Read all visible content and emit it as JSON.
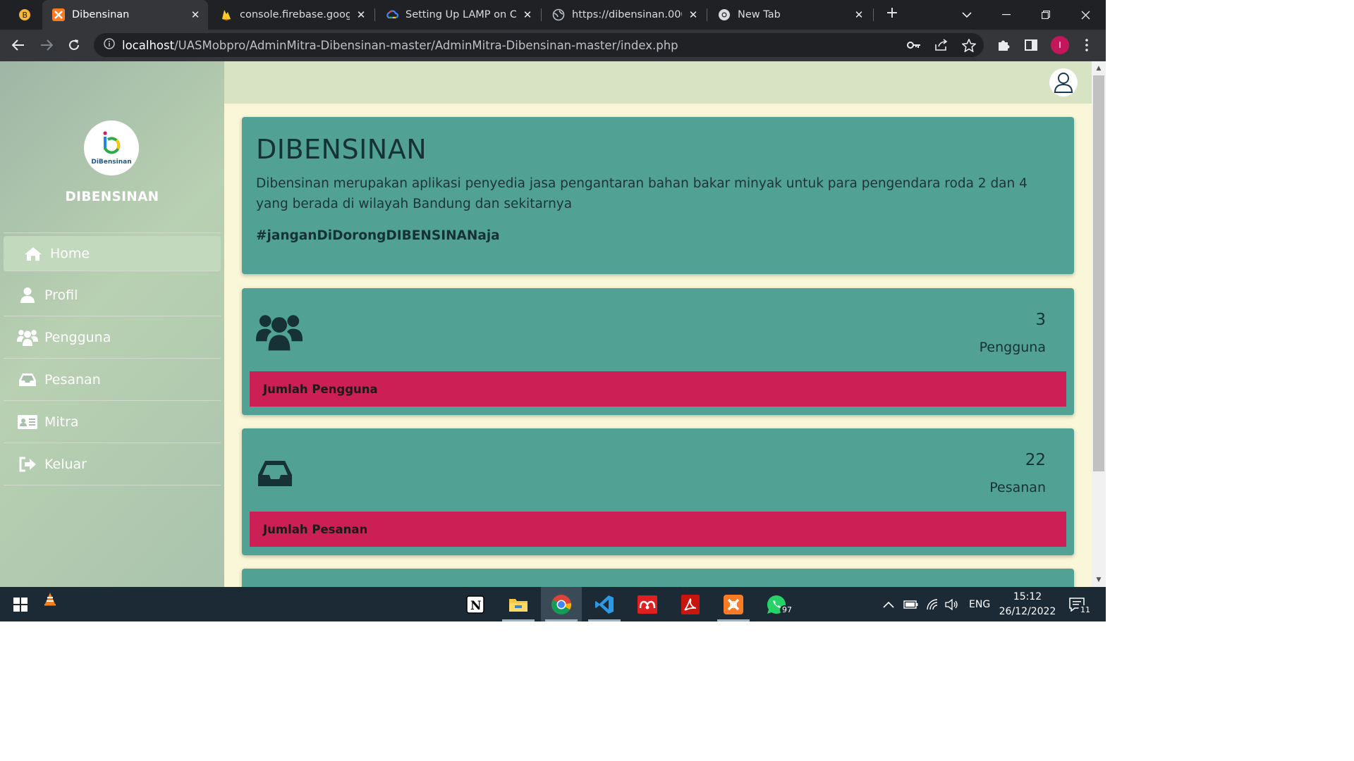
{
  "browser": {
    "tabs": [
      {
        "title": "Dibensinan",
        "active": true
      },
      {
        "title": "console.firebase.google.",
        "active": false
      },
      {
        "title": "Setting Up LAMP on Co",
        "active": false
      },
      {
        "title": "https://dibensinan.000w",
        "active": false
      },
      {
        "title": "New Tab",
        "active": false
      }
    ],
    "url_host": "localhost",
    "url_path": "/UASMobpro/AdminMitra-Dibensinan-master/AdminMitra-Dibensinan-master/index.php",
    "profile_initial": "I"
  },
  "sidebar": {
    "logo_text": "DiBensinan",
    "brand": "DIBENSINAN",
    "items": [
      {
        "label": "Home",
        "icon": "home-icon",
        "active": true
      },
      {
        "label": "Profil",
        "icon": "user-icon",
        "active": false
      },
      {
        "label": "Pengguna",
        "icon": "users-icon",
        "active": false
      },
      {
        "label": "Pesanan",
        "icon": "inbox-icon",
        "active": false
      },
      {
        "label": "Mitra",
        "icon": "id-card-icon",
        "active": false
      },
      {
        "label": "Keluar",
        "icon": "sign-out-icon",
        "active": false
      }
    ]
  },
  "main": {
    "title": "DIBENSINAN",
    "description": "Dibensinan merupakan aplikasi penyedia jasa pengantaran bahan bakar minyak untuk para pengendara roda 2 dan 4 yang berada di wilayah Bandung dan sekitarnya",
    "hashtag": "#janganDiDorongDIBENSINANaja",
    "cards": [
      {
        "count": "3",
        "label": "Pengguna",
        "footer": "Jumlah Pengguna",
        "icon": "users-icon"
      },
      {
        "count": "22",
        "label": "Pesanan",
        "footer": "Jumlah Pesanan",
        "icon": "inbox-icon"
      }
    ]
  },
  "taskbar": {
    "language": "ENG",
    "time": "15:12",
    "date": "26/12/2022",
    "whatsapp_badge": "97",
    "notification_badge": "11"
  },
  "colors": {
    "card_teal": "#51a194",
    "footer_red": "#cb1f55",
    "sidebar_green": "#b9d0b2"
  }
}
